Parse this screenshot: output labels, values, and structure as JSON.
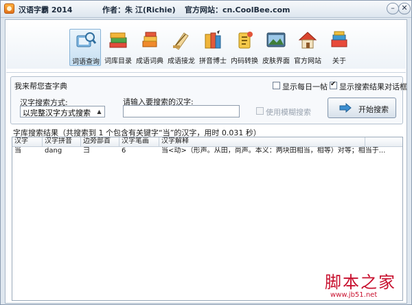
{
  "window": {
    "app_title": "汉语字霸 2014",
    "author": "作者：朱 江(Richie)",
    "website": "官方网站：cn.CoolBee.com",
    "minimize_label": "–",
    "close_label": "✕"
  },
  "toolbar": {
    "items": [
      {
        "label": "词语查询",
        "icon": "book-magnifier-icon",
        "active": true
      },
      {
        "label": "词库目录",
        "icon": "stacked-books-icon",
        "active": false
      },
      {
        "label": "成语词典",
        "icon": "dictionary-icon",
        "active": false
      },
      {
        "label": "成语接龙",
        "icon": "dragon-chain-icon",
        "active": false
      },
      {
        "label": "拼音博士",
        "icon": "pinyin-icon",
        "active": false
      },
      {
        "label": "内码转换",
        "icon": "convert-icon",
        "active": false
      },
      {
        "label": "皮肤界面",
        "icon": "skin-icon",
        "active": false
      },
      {
        "label": "官方网站",
        "icon": "home-icon",
        "active": false
      },
      {
        "label": "关于",
        "icon": "about-icon",
        "active": false
      }
    ]
  },
  "search_panel": {
    "title": "我来帮您查字典",
    "show_daily_label": "显示每日一帖",
    "show_daily_checked": false,
    "show_result_dialog_label": "显示搜索结果对话框",
    "show_result_dialog_checked": true,
    "mode_label": "汉字搜索方式:",
    "mode_value": "以完整汉字方式搜索",
    "input_label": "请输入要搜索的汉字:",
    "input_value": "",
    "fuzzy_label": "使用模糊搜索",
    "fuzzy_checked": false,
    "search_button_label": "开始搜索"
  },
  "results": {
    "caption": "字库搜索结果（共搜索到 1 个包含有关键字“当”的汉字，用时 0.031 秒）",
    "columns": [
      "汉字",
      "汉字拼音",
      "边旁部首",
      "汉字笔画",
      "汉字解释"
    ],
    "rows": [
      {
        "char": "当",
        "pinyin": "dang",
        "radical": "彐",
        "strokes": "6",
        "explanation": "当<动>（形声。从田，尚声。本义：两块田相当，相等）对等；相当于..."
      }
    ]
  },
  "watermark": {
    "main": "脚本之家",
    "sub": "www.jb51.net"
  },
  "colors": {
    "accent": "#c8102e",
    "window_bg": "#dfe7ef",
    "active_tool": "#c6dff2"
  }
}
